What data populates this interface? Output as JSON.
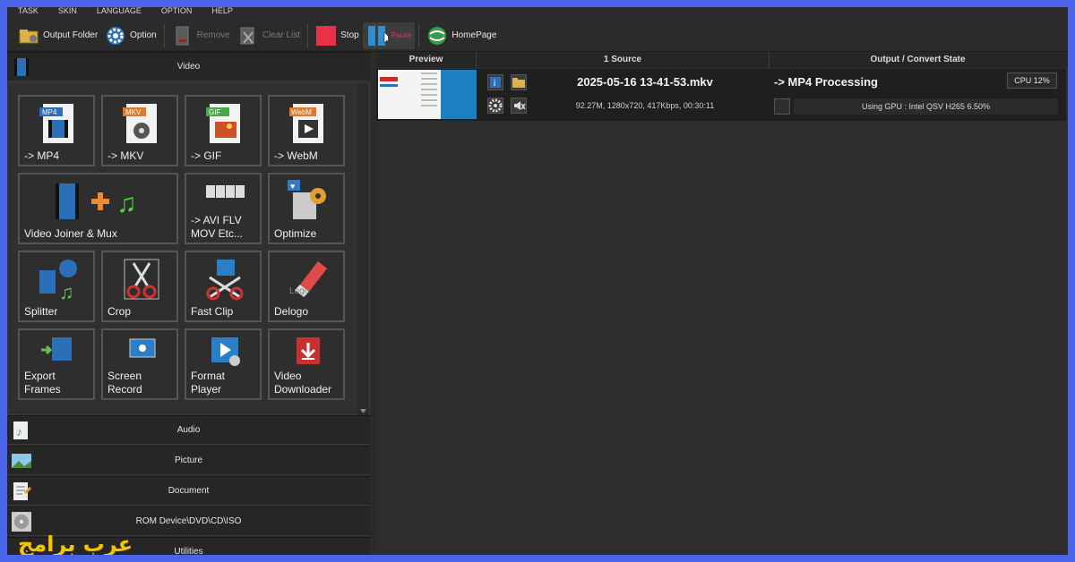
{
  "menu": [
    "TASK",
    "SKIN",
    "LANGUAGE",
    "OPTION",
    "HELP"
  ],
  "toolbar": {
    "output_folder": "Output Folder",
    "option": "Option",
    "remove": "Remove",
    "clear_list": "Clear List",
    "stop": "Stop",
    "pause": "Pause",
    "homepage": "HomePage"
  },
  "sidebar": {
    "video_header": "Video",
    "tiles": [
      {
        "label": "-> MP4",
        "badge": "MP4"
      },
      {
        "label": "-> MKV",
        "badge": "MKV"
      },
      {
        "label": "-> GIF",
        "badge": "GIF"
      },
      {
        "label": "-> WebM",
        "badge": "WebM"
      },
      {
        "label": "Video Joiner & Mux"
      },
      {
        "label": "-> AVI FLV MOV Etc..."
      },
      {
        "label": "Optimize"
      },
      {
        "label": "Splitter"
      },
      {
        "label": "Crop"
      },
      {
        "label": "Fast Clip"
      },
      {
        "label": "Delogo"
      },
      {
        "label": "Export Frames"
      },
      {
        "label": "Screen Record"
      },
      {
        "label": "Format Player"
      },
      {
        "label": "Video Downloader"
      }
    ],
    "categories": [
      "Audio",
      "Picture",
      "Document",
      "ROM Device\\DVD\\CD\\ISO",
      "Utilities"
    ]
  },
  "list": {
    "columns": [
      "Preview",
      "1 Source",
      "Output / Convert State"
    ],
    "rows": [
      {
        "filename": "2025-05-16 13-41-53.mkv",
        "info": "92.27M, 1280x720, 417Kbps, 00:30:11",
        "state": "-> MP4 Processing",
        "cpu": "CPU 12%",
        "gpu": "Using GPU : Intel QSV H265 6.50%"
      }
    ]
  },
  "watermark": "عرب برامج",
  "colors": {
    "stop": "#e8324a",
    "thumb": "#1c7fc0",
    "watermark": "#f5c400"
  }
}
